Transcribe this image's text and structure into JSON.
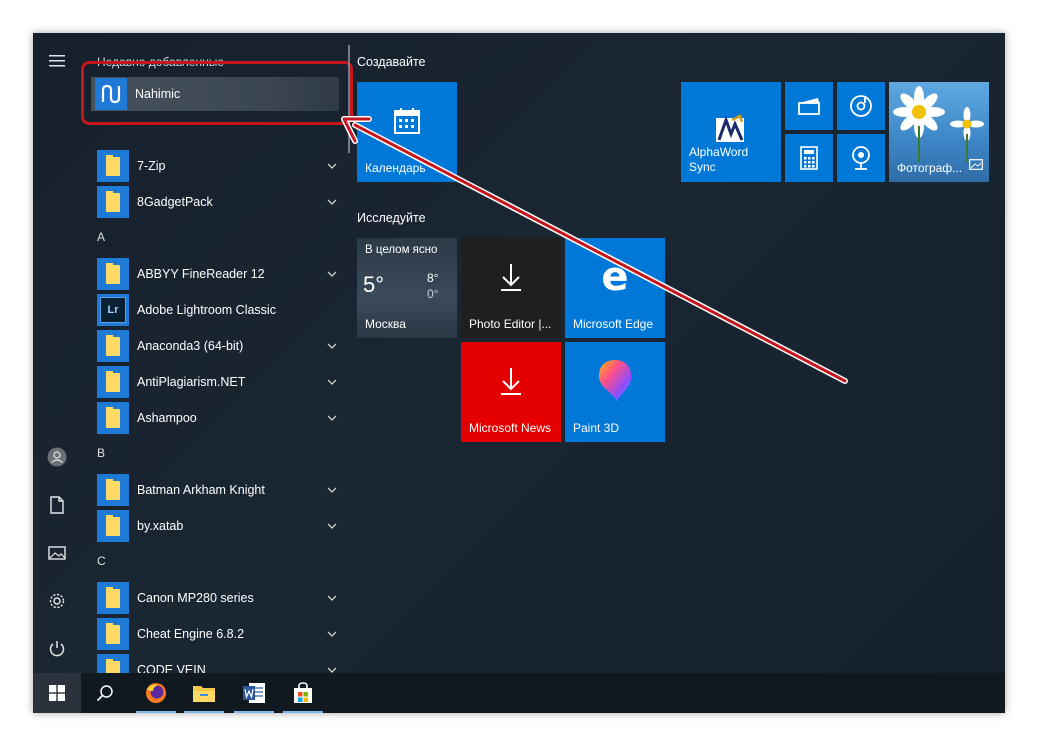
{
  "recent": {
    "title": "Недавно добавленные",
    "app": "Nahimic"
  },
  "apps": [
    {
      "label": "7-Zip",
      "expandable": true
    },
    {
      "label": "8GadgetPack",
      "expandable": true
    },
    {
      "letter": "A"
    },
    {
      "label": "ABBYY FineReader 12",
      "expandable": true
    },
    {
      "label": "Adobe Lightroom Classic",
      "expandable": false
    },
    {
      "label": "Anaconda3 (64-bit)",
      "expandable": true
    },
    {
      "label": "AntiPlagiarism.NET",
      "expandable": true
    },
    {
      "label": "Ashampoo",
      "expandable": true
    },
    {
      "letter": "B"
    },
    {
      "label": "Batman Arkham Knight",
      "expandable": true
    },
    {
      "label": "by.xatab",
      "expandable": true
    },
    {
      "letter": "C"
    },
    {
      "label": "Canon MP280 series",
      "expandable": true
    },
    {
      "label": "Cheat Engine 6.8.2",
      "expandable": true
    },
    {
      "label": "CODE VEIN",
      "expandable": true
    }
  ],
  "tiles": {
    "group1_title": "Создавайте",
    "group2_title": "Исследуйте",
    "calendar": "Календарь",
    "alphaword": "AlphaWord\nSync",
    "photos": "Фотограф...",
    "weather": {
      "condition": "В целом ясно",
      "temp": "5°",
      "high": "8°",
      "low": "0°",
      "city": "Москва"
    },
    "photo_editor": "Photo Editor |...",
    "edge": "Microsoft Edge",
    "news": "Microsoft News",
    "paint3d": "Paint 3D"
  },
  "colors": {
    "accent": "#0078d7",
    "news_red": "#e50000",
    "dark_tile": "#1f1f1f",
    "highlight_red": "#c4161c"
  },
  "rail_icons": [
    "hamburger-icon",
    "user-icon",
    "documents-icon",
    "pictures-icon",
    "settings-icon",
    "power-icon"
  ],
  "taskbar_icons": [
    "windows-start-icon",
    "search-icon",
    "firefox-icon",
    "file-explorer-icon",
    "word-icon",
    "store-icon"
  ]
}
